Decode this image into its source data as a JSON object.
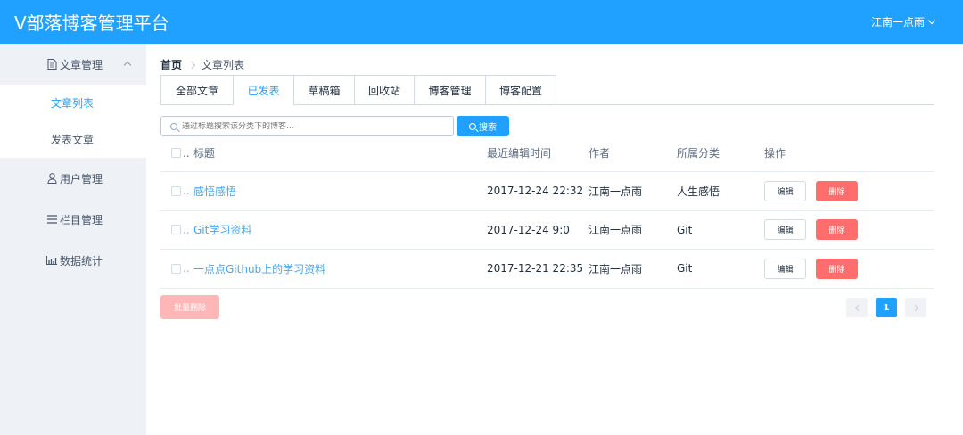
{
  "header": {
    "title": "V部落博客管理平台",
    "user": "江南一点雨"
  },
  "sidebar": {
    "article_menu": "文章管理",
    "article_list": "文章列表",
    "publish": "发表文章",
    "user_menu": "用户管理",
    "column_menu": "栏目管理",
    "stats_menu": "数据统计"
  },
  "breadcrumb": {
    "home": "首页",
    "current": "文章列表"
  },
  "tabs": [
    "全部文章",
    "已发表",
    "草稿箱",
    "回收站",
    "博客管理",
    "博客配置"
  ],
  "search": {
    "placeholder": "通过标题搜索该分类下的博客...",
    "button": "搜索"
  },
  "table": {
    "headers": {
      "title": "标题",
      "time": "最近编辑时间",
      "author": "作者",
      "category": "所属分类",
      "ops": "操作"
    },
    "rows": [
      {
        "title": "感悟感悟",
        "time": "2017-12-24 22:32",
        "author": "江南一点雨",
        "category": "人生感悟"
      },
      {
        "title": "Git学习资料",
        "time": "2017-12-24 9:0",
        "author": "江南一点雨",
        "category": "Git"
      },
      {
        "title": "一点点Github上的学习资料",
        "time": "2017-12-21 22:35",
        "author": "江南一点雨",
        "category": "Git"
      }
    ],
    "edit_label": "编辑",
    "delete_label": "删除",
    "check_ellipsis": ".."
  },
  "batch_delete": "批量删除",
  "pagination": {
    "current": "1"
  },
  "colors": {
    "primary": "#20a0ff",
    "danger": "#ff6d6d",
    "sidebar_bg": "#eef1f6"
  }
}
